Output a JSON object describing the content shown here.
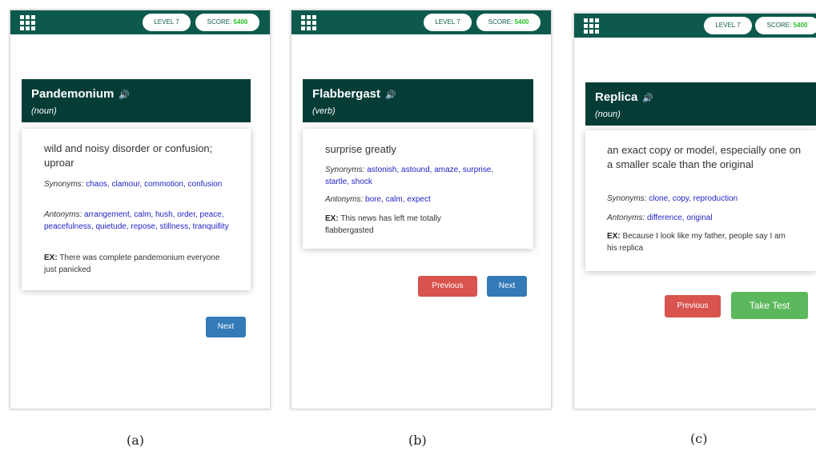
{
  "panels": [
    {
      "level": "LEVEL 7",
      "score_label": "SCORE:",
      "score_value": "5400",
      "word": "Pandemonium",
      "pos": "(noun)",
      "definition": "wild and noisy disorder or confusion; uproar",
      "synonyms_label": "Synonyms:",
      "synonyms": "chaos, clamour, commotion, confusion",
      "antonyms_label": "Antonyms:",
      "antonyms": "arrangement, calm, hush, order, peace, peacefulness, quietude, repose, stillness, tranquillity",
      "ex_label": "EX:",
      "example": "There was complete pandemonium everyone just panicked",
      "next_label": "Next",
      "caption": "(a)"
    },
    {
      "level": "LEVEL 7",
      "score_label": "SCORE:",
      "score_value": "5400",
      "word": "Flabbergast",
      "pos": "(verb)",
      "definition": "surprise greatly",
      "synonyms_label": "Synonyms:",
      "synonyms": "astonish, astound, amaze, surprise, startle, shock",
      "antonyms_label": "Antonyms:",
      "antonyms": "bore, calm, expect",
      "ex_label": "EX:",
      "example": "This news has left me totally flabbergasted",
      "previous_label": "Previous",
      "next_label": "Next",
      "caption": "(b)"
    },
    {
      "level": "LEVEL 7",
      "score_label": "SCORE:",
      "score_value": "5400",
      "word": "Replica",
      "pos": "(noun)",
      "definition": "an exact copy or model, especially one on a smaller scale than the original",
      "synonyms_label": "Synonyms:",
      "synonyms": "clone, copy, reproduction",
      "antonyms_label": "Antonyms:",
      "antonyms": "difference, original",
      "ex_label": "EX:",
      "example": "Because I look like my father, people say I am his replica",
      "previous_label": "Previous",
      "take_test_label": "Take Test",
      "caption": "(c)"
    }
  ],
  "colors": {
    "topbar": "#0d5a4d",
    "word_header": "#053d36",
    "link": "#2323c8",
    "next_button": "#337ab7",
    "previous_button": "#d9534f",
    "take_test_button": "#5cb85c",
    "score_value": "#22c022"
  },
  "icons": [
    "app-grid-icon",
    "speaker-icon"
  ]
}
